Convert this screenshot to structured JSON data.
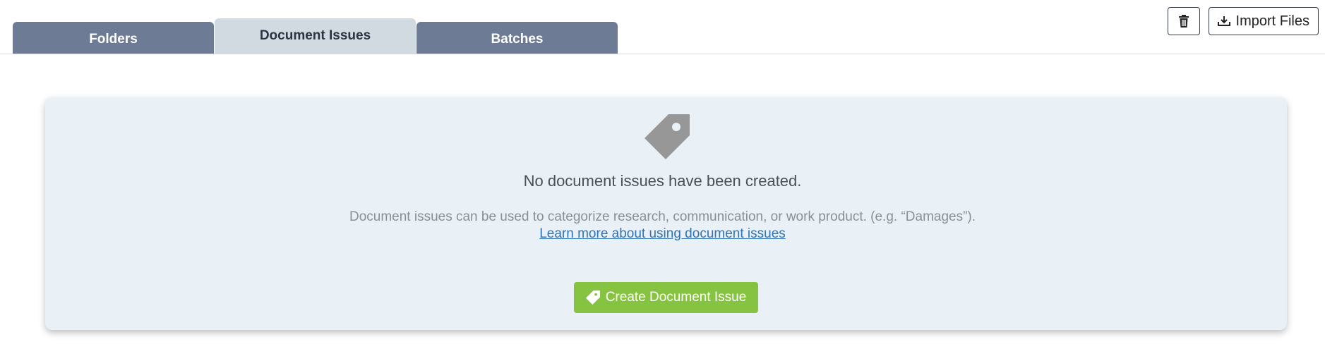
{
  "tabs": [
    {
      "label": "Folders",
      "active": false
    },
    {
      "label": "Document Issues",
      "active": true
    },
    {
      "label": "Batches",
      "active": false
    }
  ],
  "actions": {
    "delete_icon": "trash-icon",
    "import_label": "Import Files",
    "import_icon": "download-tray-icon"
  },
  "empty_state": {
    "icon": "tag-icon",
    "title": "No document issues have been created.",
    "description": "Document issues can be used to categorize research, communication, or work product. (e.g. “Damages”).",
    "learn_more_link": "Learn more about using document issues",
    "create_button_label": "Create Document Issue"
  },
  "colors": {
    "tab_inactive": "#6e7b94",
    "tab_active": "#d1d9e1",
    "panel_bg": "#e9f0f6",
    "create_button": "#86c340",
    "link": "#2f73b8"
  }
}
